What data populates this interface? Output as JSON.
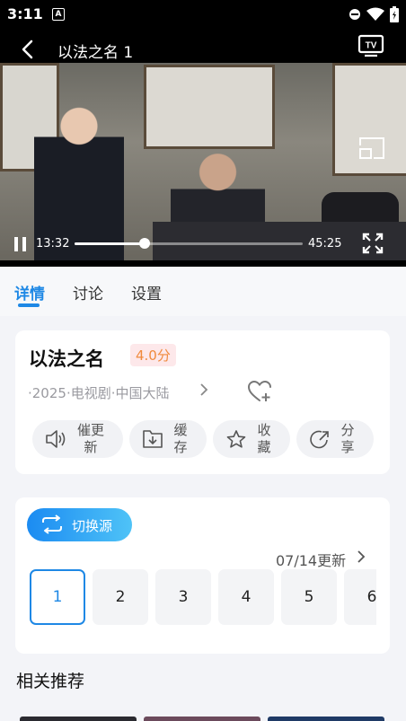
{
  "status_bar": {
    "time": "3:11",
    "app_icon_letter": "A"
  },
  "player": {
    "title": "以法之名 1",
    "current_time": "13:32",
    "total_time": "45:25",
    "progress_fraction": 0.306,
    "icons": [
      "back-icon",
      "tv-icon",
      "pip-icon",
      "pause-icon",
      "fullscreen-icon"
    ]
  },
  "tabs": [
    {
      "label": "详情",
      "active": true
    },
    {
      "label": "讨论",
      "active": false
    },
    {
      "label": "设置",
      "active": false
    }
  ],
  "info": {
    "title": "以法之名",
    "score": "4.0分",
    "meta": "·2025·电视剧·中国大陆"
  },
  "actions": [
    {
      "line1": "催更",
      "line2": "新",
      "icon": "speaker-icon"
    },
    {
      "line1": "缓",
      "line2": "存",
      "icon": "download-icon"
    },
    {
      "line1": "收",
      "line2": "藏",
      "icon": "star-icon"
    },
    {
      "line1": "分",
      "line2": "享",
      "icon": "share-icon"
    }
  ],
  "episodes": {
    "switch_source_label": "切换源",
    "update_text": "07/14更新",
    "items": [
      "1",
      "2",
      "3",
      "4",
      "5",
      "6"
    ],
    "selected": "1"
  },
  "related": {
    "title": "相关推荐"
  },
  "colors": {
    "accent": "#1e88e5",
    "score_text": "#f08a3c",
    "score_bg": "#fde8ea"
  }
}
